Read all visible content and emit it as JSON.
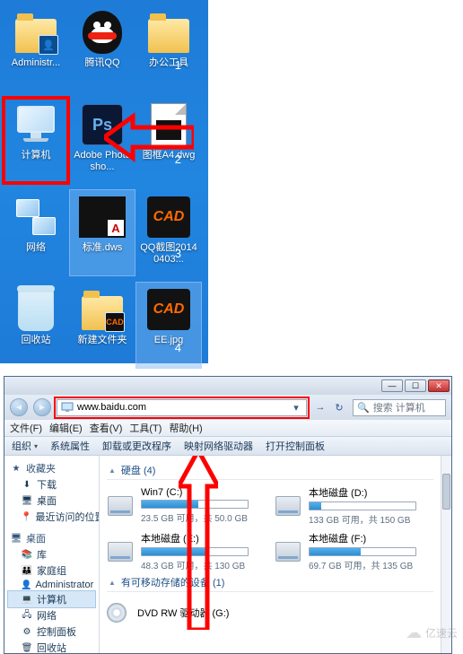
{
  "desktop": {
    "icons": [
      {
        "label": "Administr...",
        "kind": "folder-user"
      },
      {
        "label": "腾讯QQ",
        "kind": "qq"
      },
      {
        "label": "办公工具",
        "kind": "folder"
      },
      {
        "label": "计算机",
        "kind": "computer",
        "highlight": true
      },
      {
        "label": "Adobe Photosho...",
        "kind": "ps"
      },
      {
        "label": "图框A4.dwg",
        "kind": "dwg"
      },
      {
        "label": "网络",
        "kind": "network"
      },
      {
        "label": "标准.dws",
        "kind": "dws",
        "selected": true
      },
      {
        "label": "QQ截图20140403...",
        "kind": "cad"
      },
      {
        "label": "回收站",
        "kind": "bin"
      },
      {
        "label": "新建文件夹",
        "kind": "folder-cad"
      },
      {
        "label": "EE.jpg",
        "kind": "cad",
        "selected": true
      }
    ],
    "frags": [
      "1",
      "2",
      "3",
      "4"
    ]
  },
  "explorer": {
    "address": "www.baidu.com",
    "search_placeholder": "搜索 计算机",
    "menu": [
      "文件(F)",
      "编辑(E)",
      "查看(V)",
      "工具(T)",
      "帮助(H)"
    ],
    "toolbar": {
      "organize": "组织",
      "sys_props": "系统属性",
      "uninstall": "卸载或更改程序",
      "map_drive": "映射网络驱动器",
      "control_panel": "打开控制面板"
    },
    "tree": {
      "favorites": {
        "label": "收藏夹",
        "children": [
          "下载",
          "桌面",
          "最近访问的位置"
        ]
      },
      "desktop": {
        "label": "桌面",
        "children": [
          {
            "label": "库",
            "icon": "lib"
          },
          {
            "label": "家庭组",
            "icon": "home"
          },
          {
            "label": "Administrator",
            "icon": "user"
          },
          {
            "label": "计算机",
            "icon": "pc",
            "selected": true
          },
          {
            "label": "网络",
            "icon": "net"
          },
          {
            "label": "控制面板",
            "icon": "ctrl"
          },
          {
            "label": "回收站",
            "icon": "bin"
          }
        ]
      }
    },
    "sections": {
      "hdd": {
        "label": "硬盘 (4)",
        "drives": [
          {
            "name": "Win7 (C:)",
            "free": "23.5 GB 可用，共 50.0 GB",
            "fill": 53
          },
          {
            "name": "本地磁盘 (D:)",
            "free": "133 GB 可用，共 150 GB",
            "fill": 11
          },
          {
            "name": "本地磁盘 (E:)",
            "free": "48.3 GB 可用，共 130 GB",
            "fill": 63
          },
          {
            "name": "本地磁盘 (F:)",
            "free": "69.7 GB 可用，共 135 GB",
            "fill": 48
          }
        ]
      },
      "removable": {
        "label": "有可移动存储的设备 (1)",
        "items": [
          {
            "name": "DVD RW 驱动器 (G:)"
          }
        ]
      }
    }
  },
  "watermark": "亿速云"
}
